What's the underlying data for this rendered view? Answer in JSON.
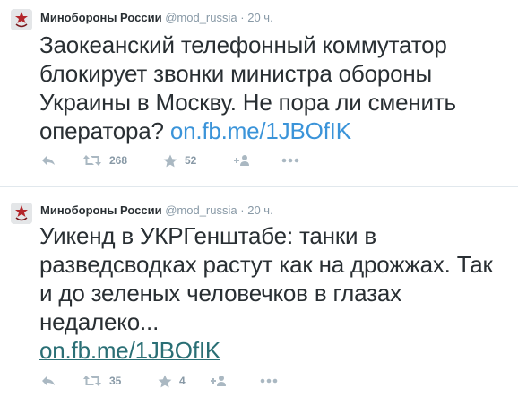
{
  "tweets": [
    {
      "author": {
        "name": "Минобороны России",
        "handle": "@mod_russia"
      },
      "separator": "·",
      "time": "20 ч.",
      "text_lines": [
        "Заокеанский телефонный коммутатор",
        "блокирует звонки министра обороны",
        "Украины в Москву. Не пора ли сменить",
        "оператора?"
      ],
      "link": "on.fb.me/1JBOfIK",
      "retweets": "268",
      "favorites": "52"
    },
    {
      "author": {
        "name": "Минобороны России",
        "handle": "@mod_russia"
      },
      "separator": "·",
      "time": "20 ч.",
      "text_lines": [
        "Уикенд в УКРГенштабе: танки в",
        "разведсводках растут как на дрожжах. Так",
        "и до зеленых человечков в глазах",
        "недалеко..."
      ],
      "link": "on.fb.me/1JBOfIK",
      "retweets": "35",
      "favorites": "4"
    }
  ],
  "icons": {
    "reply": "reply-icon",
    "retweet": "retweet-icon",
    "favorite": "star-icon",
    "follow": "follow-icon",
    "more": "more-icon"
  },
  "colors": {
    "text": "#292f33",
    "meta": "#8899a6",
    "link": "#2a6f75",
    "avatar_emblem": "#b3262b"
  }
}
